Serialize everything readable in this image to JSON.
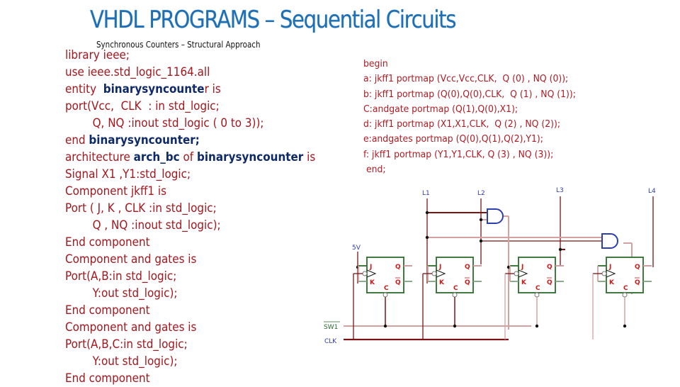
{
  "slide": {
    "title": "VHDL PROGRAMS – Sequential  Circuits",
    "subtitle": "Synchronous  Counters – Structural Approach"
  },
  "code_left": [
    [
      {
        "t": "library ieee;"
      }
    ],
    [
      {
        "t": "use ieee.std_logic_1164.all"
      }
    ],
    [
      {
        "t": "entity  "
      },
      {
        "t": "binarysyncounte",
        "b": true
      },
      {
        "t": "r is"
      }
    ],
    [
      {
        "t": "port(Vcc,  CLK  : in std_logic;"
      }
    ],
    [
      {
        "t": "        Q, NQ :inout std_logic ( 0 to 3));"
      }
    ],
    [
      {
        "t": "end "
      },
      {
        "t": "binarysyncounter;",
        "b": true
      }
    ],
    [
      {
        "t": "architecture "
      },
      {
        "t": "arch_bc",
        "b": true
      },
      {
        "t": " of "
      },
      {
        "t": "binarysyncounter",
        "b": true
      },
      {
        "t": " is"
      }
    ],
    [
      {
        "t": "Signal X1 ,Y1:std_logic;"
      }
    ],
    [
      {
        "t": "Component jkff1 is"
      }
    ],
    [
      {
        "t": "Port ( J, K , CLK :in std_logic;"
      }
    ],
    [
      {
        "t": "        Q , NQ :inout std_logic);"
      }
    ],
    [
      {
        "t": "End component"
      }
    ],
    [
      {
        "t": "Component and gates is"
      }
    ],
    [
      {
        "t": "Port(A,B:in std_logic;"
      }
    ],
    [
      {
        "t": "        Y:out std_logic);"
      }
    ],
    [
      {
        "t": "End component"
      }
    ],
    [
      {
        "t": "Component and gates is"
      }
    ],
    [
      {
        "t": "Port(A,B,C:in std_logic;"
      }
    ],
    [
      {
        "t": "        Y:out std_logic);"
      }
    ],
    [
      {
        "t": "End component"
      }
    ]
  ],
  "code_right": [
    "begin",
    "a: jkff1 portmap (Vcc,Vcc,CLK,  Q (0) , NQ (0));",
    "b: jkff1 portmap (Q(0),Q(0),CLK,  Q (1) , NQ (1));",
    "C:andgate portmap (Q(1),Q(0),X1);",
    "d: jkff1 portmap (X1,X1,CLK,  Q (2) , NQ (2));",
    "e:andgates portmap (Q(0),Q(1),Q(2),Y1);",
    "f: jkff1 portmap (Y1,Y1,CLK, Q (3) , NQ (3));",
    " end;"
  ],
  "circuit": {
    "supply_label": "5V",
    "switch_label": "SW1",
    "clock_label": "CLK",
    "led_labels": [
      "L1",
      "L2",
      "L3",
      "L4"
    ],
    "flipflop_pins": {
      "j": "J",
      "k": "K",
      "q": "Q",
      "nq": "Q",
      "clear": "C"
    },
    "flipflop_count": 4,
    "and_gate_count": 2,
    "colors": {
      "wire_dark": "#7a1515",
      "wire_light": "#d4a0a0",
      "flipflop_border": "#2b6b2b",
      "gate_border": "#2c3fb0",
      "pin_label": "#d01818",
      "net_label": "#2a3aa8"
    }
  }
}
